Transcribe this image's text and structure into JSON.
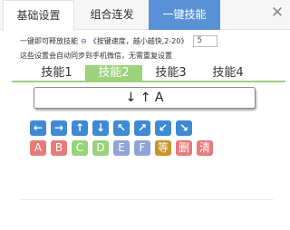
{
  "tabs": {
    "basic": "基础设置",
    "combo": "组合连发",
    "oneclick": "一键技能"
  },
  "close_label": "✕",
  "settings": {
    "line1_prefix": "一键即可释放技能",
    "line1_icon": "⊖",
    "line1_speed_label": "《按键速度，越小越快,2-20》",
    "speed_value": "5",
    "line2": "这些设置会自动同步到手机微信，无需重复设置"
  },
  "skill_tabs": [
    "技能1",
    "技能2",
    "技能3",
    "技能4"
  ],
  "active_skill_tab": "技能2",
  "display_text": "↓ ↑ A",
  "arrow_keys": [
    "←",
    "→",
    "↑",
    "↓",
    "↖",
    "↗",
    "↙",
    "↘"
  ],
  "letter_keys": [
    {
      "label": "A",
      "color": "#e87a7a"
    },
    {
      "label": "B",
      "color": "#e87a7a"
    },
    {
      "label": "C",
      "color": "#98d27a"
    },
    {
      "label": "D",
      "color": "#98d27a"
    },
    {
      "label": "E",
      "color": "#8ea4d8"
    },
    {
      "label": "F",
      "color": "#8ea4d8"
    },
    {
      "label": "等",
      "color": "#c9922a"
    },
    {
      "label": "删",
      "color": "#e87a7a"
    },
    {
      "label": "清",
      "color": "#e87a7a"
    }
  ],
  "colors": {
    "accent_blue": "#5a91d6",
    "active_green": "#9bd27c",
    "arrow_key_blue": "#3f8ad4"
  }
}
